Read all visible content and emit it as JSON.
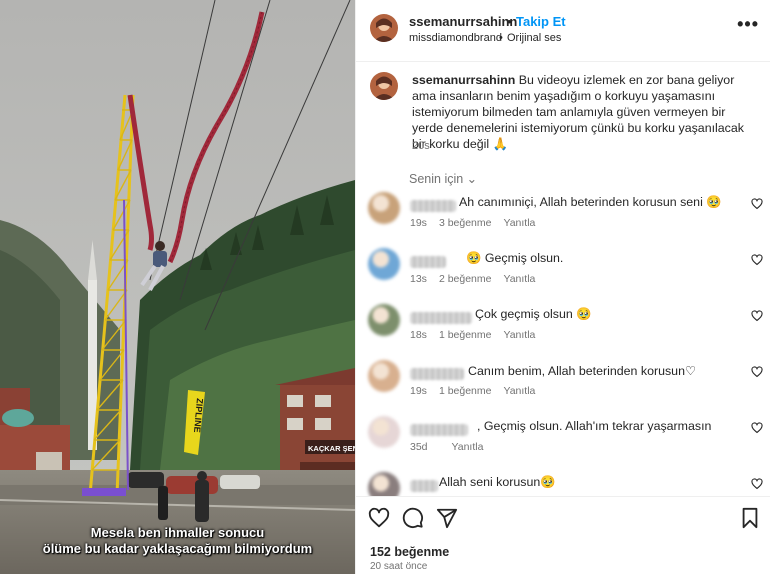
{
  "post": {
    "author": "ssemanurrsahinn",
    "separator": "•",
    "follow_label": "Takip Et",
    "audio_owner": "missdiamondbrand",
    "audio_separator": "•",
    "audio_label": "Orijinal ses",
    "more_label": "•••",
    "caption_author": "ssemanurrsahinn",
    "caption_text": "Bu videoyu izlemek en zor bana geliyor ama insanların benim yaşadığım o korkuyu yaşamasını istemiyorum bilmeden tam anlamıyla güven vermeyen bir yerde denemelerini istemiyorum çünkü bu korku yaşanılacak bir korku değil 🙏",
    "caption_age": "20s",
    "sort_label": "Senin için ⌄",
    "likes": "152 beğenme",
    "posted": "20 saat önce"
  },
  "media": {
    "subtitle_line1": "Mesela ben ihmaller sonucu",
    "subtitle_line2": "ölüme bu kadar yaklaşacağımı bilmiyordum",
    "sign_zipline": "ZIPLINE",
    "sign_building": "KAÇKAR ŞEN"
  },
  "comments": [
    {
      "text": "Ah canımıniçi, Allah beterinden korusun seni 🥹",
      "age": "19s",
      "likes": "3 beğenme",
      "reply": "Yanıtla",
      "avatar_color": "#c8a27a"
    },
    {
      "text": "🥹 Geçmiş olsun.",
      "age": "13s",
      "likes": "2 beğenme",
      "reply": "Yanıtla",
      "avatar_color": "#6fa7d6"
    },
    {
      "text": "Çok geçmiş olsun 🥹",
      "age": "18s",
      "likes": "1 beğenme",
      "reply": "Yanıtla",
      "avatar_color": "#7d8f6c"
    },
    {
      "text": "Canım benim, Allah beterinden korusun♡",
      "age": "19s",
      "likes": "1 beğenme",
      "reply": "Yanıtla",
      "avatar_color": "#d8b08f"
    },
    {
      "text": ", Geçmiş olsun. Allah'ım tekrar yaşarmasın",
      "age": "35d",
      "likes": "",
      "reply": "Yanıtla",
      "avatar_color": "#e6d6d6"
    },
    {
      "text": "Allah seni korusun🥹",
      "age": "",
      "likes": "",
      "reply": "",
      "avatar_color": "#8a7e7e"
    }
  ],
  "colors": {
    "accent": "#0095f6",
    "text": "#262626",
    "muted": "#737373",
    "divider": "#efefef"
  },
  "icons": {
    "like": "heart-outline-icon",
    "comment": "comment-bubble-icon",
    "share": "paper-plane-icon",
    "save": "bookmark-icon",
    "more": "ellipsis-icon"
  }
}
